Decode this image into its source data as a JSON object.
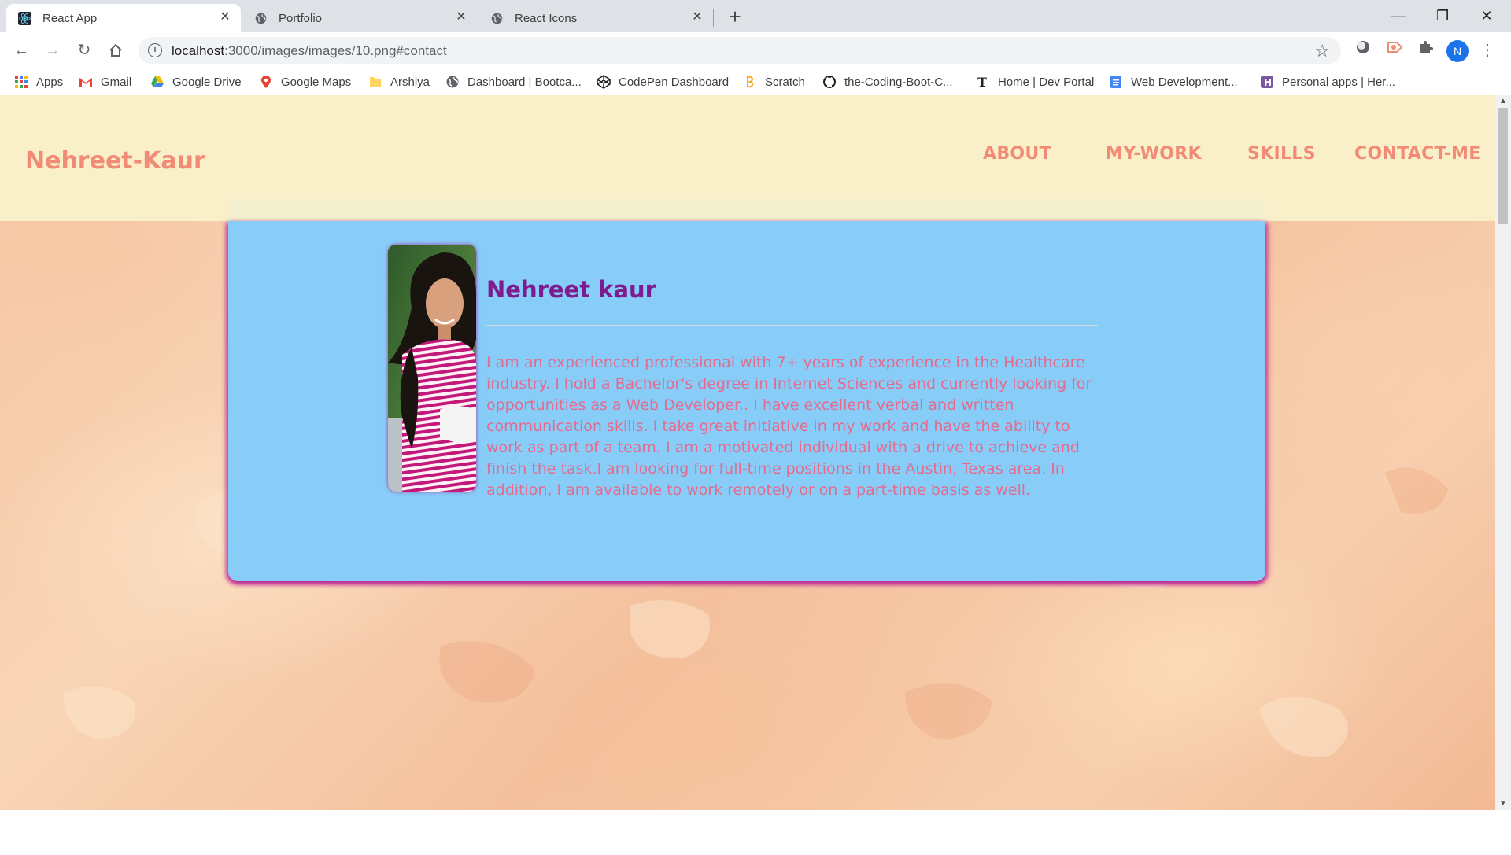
{
  "browser": {
    "tabs": [
      {
        "title": "React App",
        "active": true,
        "icon": "react-icon"
      },
      {
        "title": "Portfolio",
        "active": false,
        "icon": "globe-icon"
      },
      {
        "title": "React Icons",
        "active": false,
        "icon": "globe-icon"
      }
    ],
    "url_host": "localhost",
    "url_path": ":3000/images/images/10.png#contact",
    "profile_initial": "N",
    "bookmarks": [
      {
        "label": "Apps",
        "icon": "apps-grid-icon"
      },
      {
        "label": "Gmail",
        "icon": "gmail-icon"
      },
      {
        "label": "Google Drive",
        "icon": "google-drive-icon"
      },
      {
        "label": "Google Maps",
        "icon": "google-maps-icon"
      },
      {
        "label": "Arshiya",
        "icon": "folder-icon"
      },
      {
        "label": "Dashboard | Bootca...",
        "icon": "globe-icon"
      },
      {
        "label": "CodePen Dashboard",
        "icon": "codepen-icon"
      },
      {
        "label": "Scratch",
        "icon": "scratch-icon"
      },
      {
        "label": "the-Coding-Boot-C...",
        "icon": "github-icon"
      },
      {
        "label": "Home | Dev Portal",
        "icon": "nyt-icon"
      },
      {
        "label": "Web Development...",
        "icon": "docs-icon"
      },
      {
        "label": "Personal apps | Her...",
        "icon": "heroku-icon"
      }
    ]
  },
  "site": {
    "brand": "Nehreet-Kaur",
    "nav": [
      "ABOUT",
      "MY-WORK",
      "SKILLS",
      "CONTACT-ME"
    ],
    "profile": {
      "name": "Nehreet kaur",
      "bio": "I am an experienced professional with 7+ years of experience in the Healthcare industry. I hold a Bachelor's degree in Internet Sciences and currently looking for opportunities as a Web Developer.. I have excellent verbal and written communication skills. I take great initiative in my work and have the ability to work as part of a team. I am a motivated individual with a drive to achieve and finish the task.I am looking for full-time positions in the Austin, Texas area. In addition, I am available to work remotely or on a part-time basis as well."
    }
  },
  "colors": {
    "brand": "#f28b76",
    "name": "#7e1b8f",
    "bio": "#e56b8e",
    "card": "#87cdf8",
    "header": "#f9efc9"
  }
}
